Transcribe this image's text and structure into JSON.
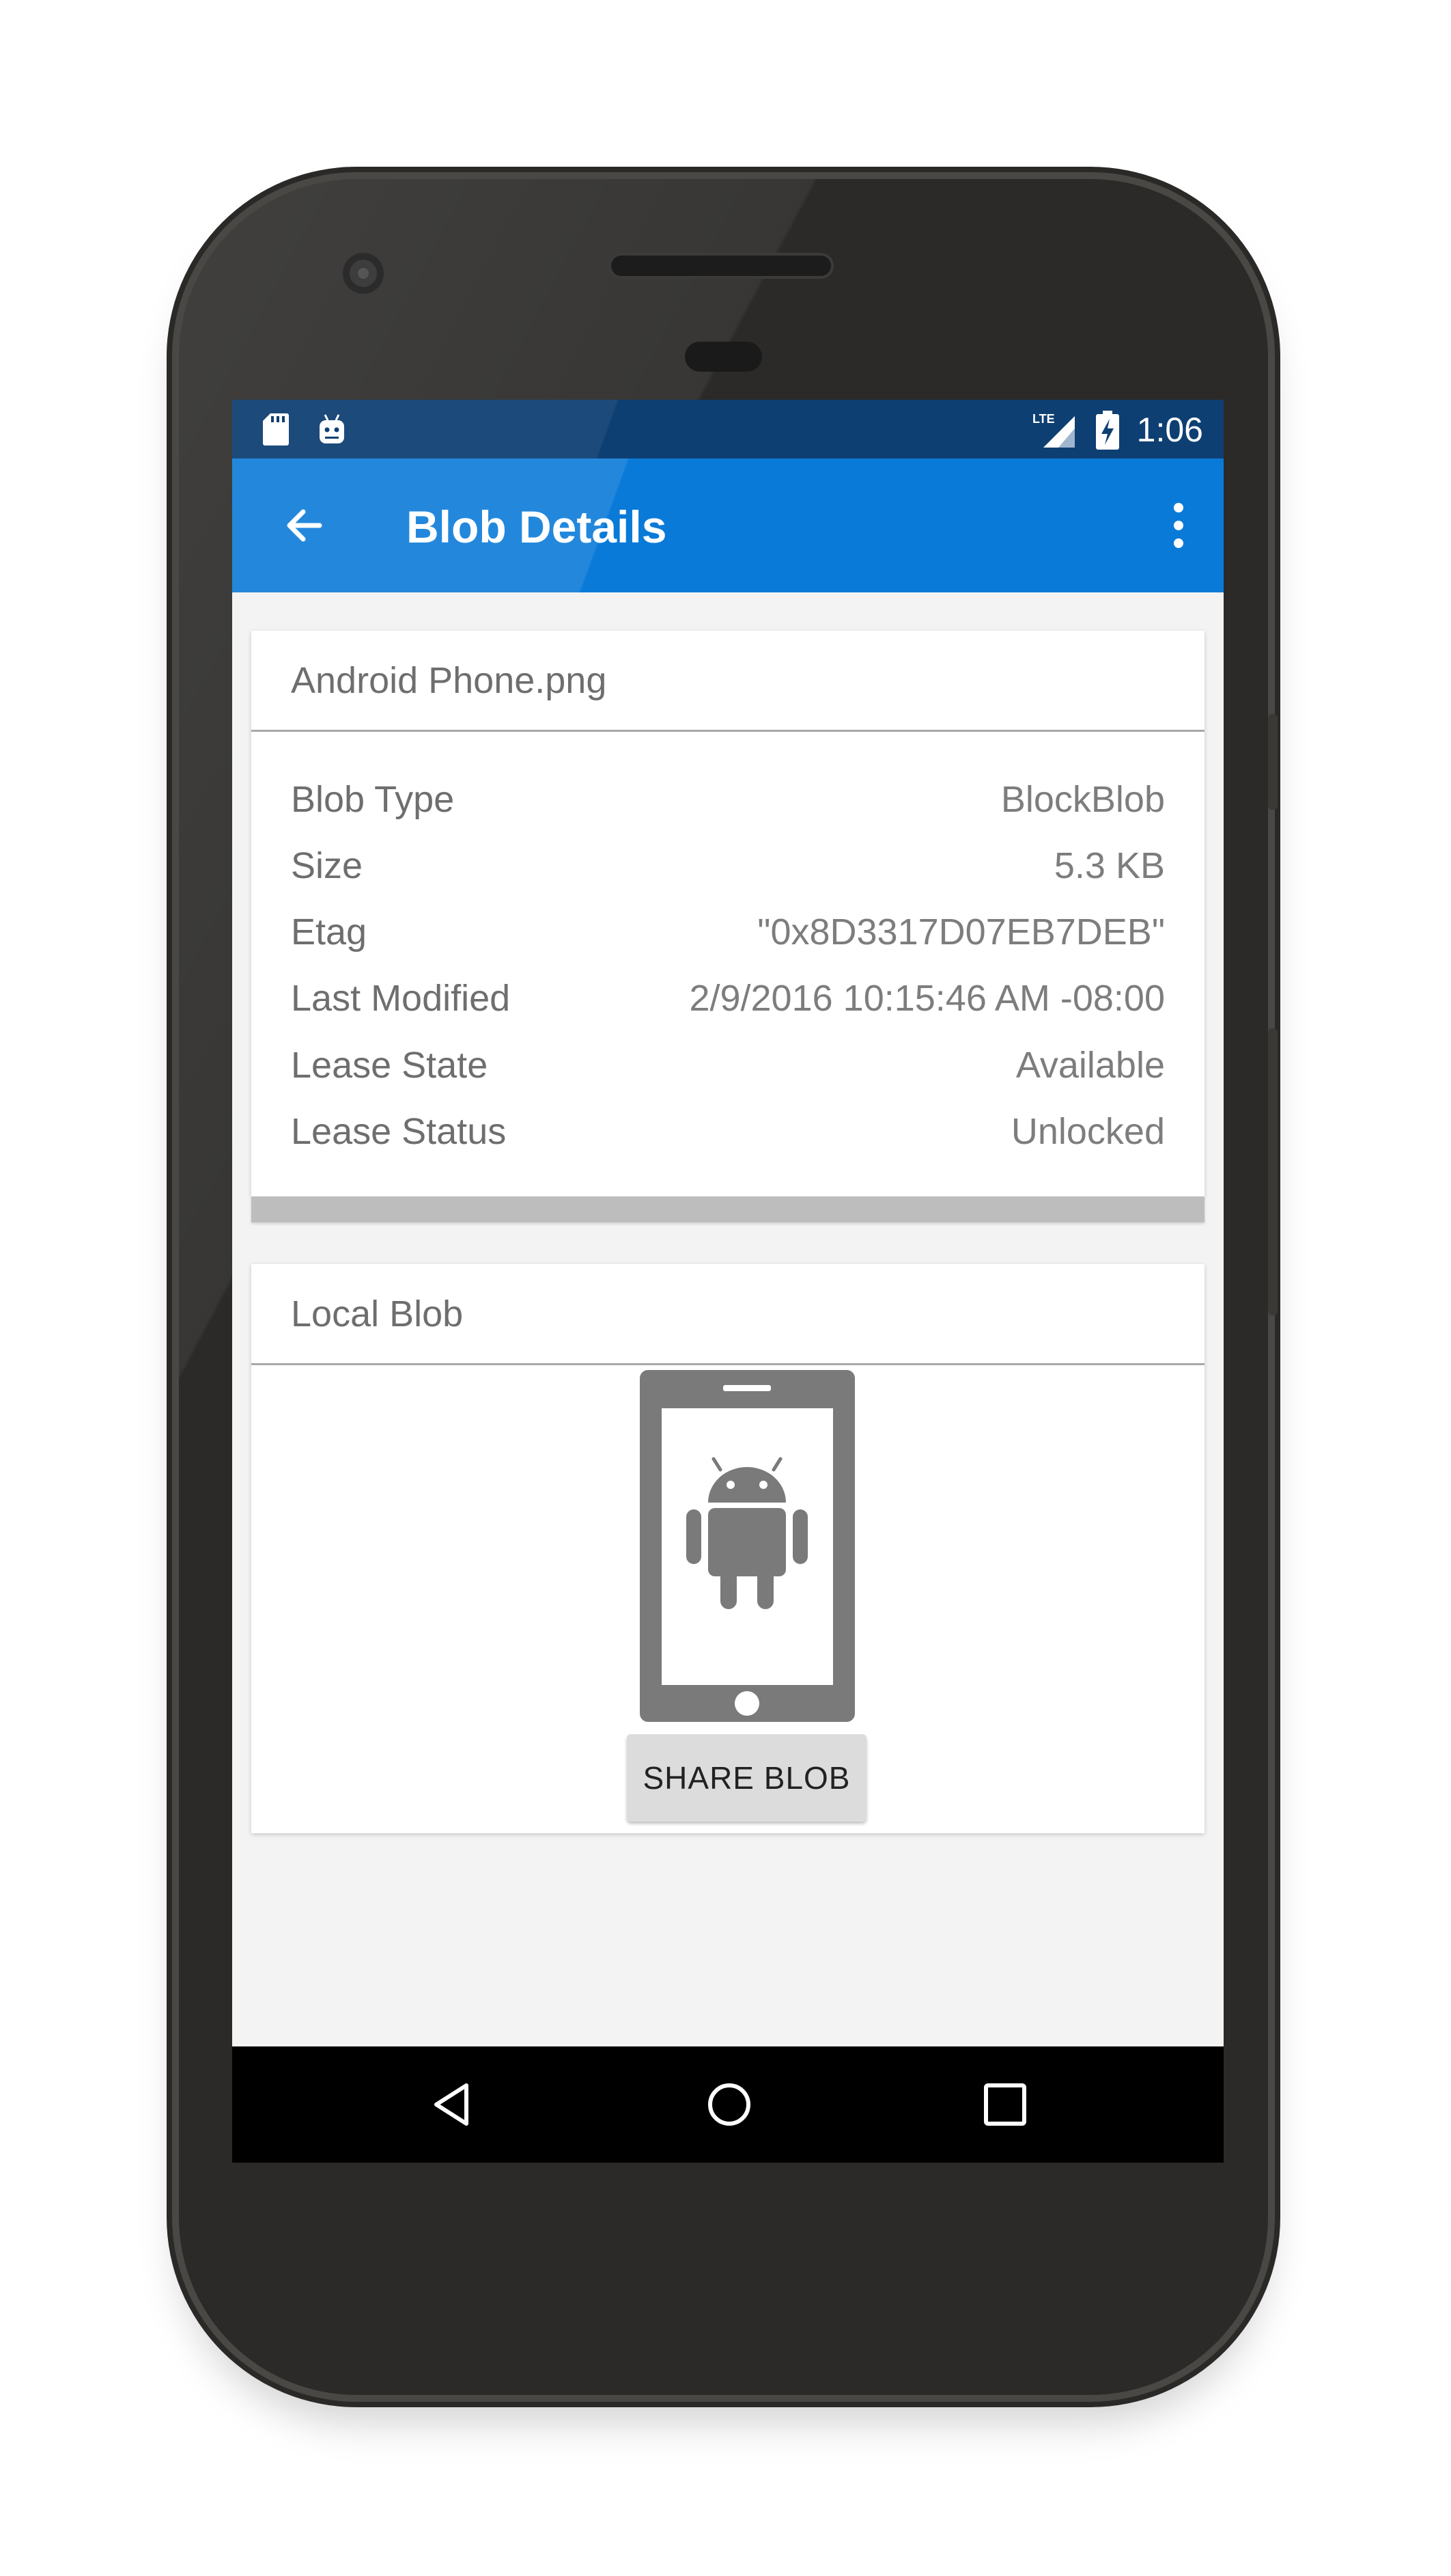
{
  "status_bar": {
    "time": "1:06",
    "lte_label": "LTE",
    "icons": [
      "sd-card-icon",
      "android-notification-icon",
      "lte-signal-icon",
      "battery-charging-icon"
    ]
  },
  "app_bar": {
    "title": "Blob Details",
    "icons": [
      "arrow-back-icon",
      "more-vert-icon"
    ]
  },
  "details_card": {
    "title": "Android Phone.png",
    "rows": [
      {
        "label": "Blob Type",
        "value": "BlockBlob"
      },
      {
        "label": "Size",
        "value": "5.3 KB"
      },
      {
        "label": "Etag",
        "value": "\"0x8D3317D07EB7DEB\""
      },
      {
        "label": "Last Modified",
        "value": "2/9/2016 10:15:46 AM -08:00"
      },
      {
        "label": "Lease State",
        "value": "Available"
      },
      {
        "label": "Lease Status",
        "value": "Unlocked"
      }
    ]
  },
  "local_blob_card": {
    "title": "Local Blob",
    "image": "android-phone-image",
    "share_button": "SHARE BLOB"
  },
  "nav_bar": {
    "icons": [
      "nav-back-icon",
      "nav-home-icon",
      "nav-recents-icon"
    ]
  },
  "colors": {
    "app_bar": "#0a7ad8",
    "status_bar": "#0e3f73",
    "screen_background": "#f3f3f3",
    "phone_body": "#2b2a28",
    "image_gray": "#7a7a7a"
  }
}
